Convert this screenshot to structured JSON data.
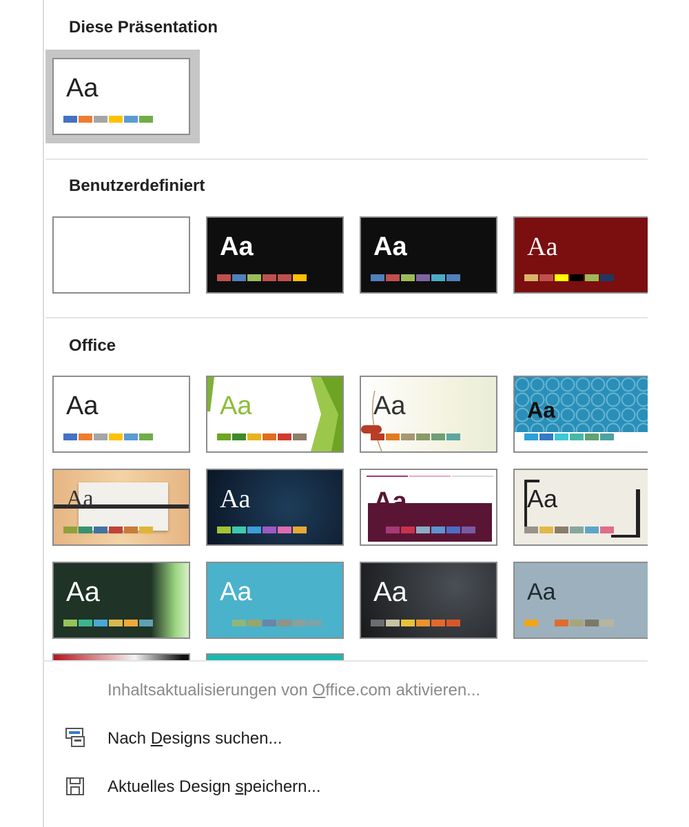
{
  "sections": {
    "this_presentation": "Diese Präsentation",
    "custom": "Benutzerdefiniert",
    "office": "Office"
  },
  "preview_text": "Aa",
  "themes": {
    "this_presentation": [
      {
        "swatches": [
          "#4472c4",
          "#ed7d31",
          "#a5a5a5",
          "#ffc000",
          "#5b9bd5",
          "#70ad47"
        ]
      }
    ],
    "custom": [
      {
        "swatches": []
      },
      {
        "swatches": [
          "#c0504d",
          "#4f81bd",
          "#9bbb59",
          "#c0504d",
          "#c0504d",
          "#ffc000"
        ]
      },
      {
        "swatches": [
          "#4f81bd",
          "#c0504d",
          "#9bbb59",
          "#8064a2",
          "#4bacc6",
          "#4f81bd"
        ]
      },
      {
        "swatches": [
          "#d9b46b",
          "#c0504d",
          "#ffff00",
          "#000000",
          "#9bbb59",
          "#1f3864"
        ]
      }
    ],
    "office": [
      {
        "swatches": [
          "#4472c4",
          "#ed7d31",
          "#a5a5a5",
          "#ffc000",
          "#5b9bd5",
          "#70ad47"
        ]
      },
      {
        "swatches": [
          "#6ea424",
          "#3c8b2a",
          "#e8b31d",
          "#e06c1f",
          "#d13b2f",
          "#8e7e6a"
        ]
      },
      {
        "swatches": [
          "#b83d25",
          "#e07b23",
          "#a7986f",
          "#8c9a69",
          "#6f9f75",
          "#5ba7a0"
        ]
      },
      {
        "swatches": [
          "#2aa0d8",
          "#3679c5",
          "#3bc9d9",
          "#46b9a5",
          "#5fa373",
          "#4ba3a3"
        ]
      },
      {
        "swatches": [
          "#8fa13a",
          "#37936e",
          "#3f73a3",
          "#c0423a",
          "#c97b3a",
          "#e0b43a"
        ]
      },
      {
        "swatches": [
          "#a1c435",
          "#3dc9b0",
          "#3b9ed8",
          "#9d59c4",
          "#e06bb1",
          "#e8a838"
        ]
      },
      {
        "swatches": [
          "#a43b77",
          "#c8324b",
          "#8cabc6",
          "#5e94d0",
          "#4f6cc4",
          "#7a5aa3"
        ]
      },
      {
        "swatches": [
          "#9a9389",
          "#e0b94a",
          "#8a7e6a",
          "#88a6a0",
          "#5da5c8",
          "#e06b8a"
        ]
      },
      {
        "swatches": [
          "#93c35b",
          "#3db48d",
          "#4aa7d6",
          "#d9b94d",
          "#f0a93a",
          "#5fa1b0"
        ]
      },
      {
        "swatches": [
          "#8fb77b",
          "#9aa569",
          "#6886a8",
          "#929287",
          "#8aa09b",
          "#7aa4ac"
        ]
      },
      {
        "swatches": [
          "#6d6d6d",
          "#c7c3a5",
          "#e8c23b",
          "#e8932f",
          "#e06a2e",
          "#d9572c"
        ]
      },
      {
        "swatches": [
          "#f0a51a",
          "#a9a9a9",
          "#e06b2e",
          "#a8a57a",
          "#7c7a66",
          "#b9b59d"
        ]
      }
    ]
  },
  "commands": {
    "enable_updates": {
      "pre": "Inhaltsaktualisierungen von ",
      "ul": "O",
      "post": "ffice.com aktivieren..."
    },
    "browse": {
      "pre": "Nach ",
      "ul": "D",
      "post": "esigns suchen..."
    },
    "save": {
      "pre": "Aktuelles Design ",
      "ul": "s",
      "post": "peichern..."
    }
  },
  "icons": {
    "browse": "browse-designs-icon",
    "save": "save-design-icon"
  }
}
